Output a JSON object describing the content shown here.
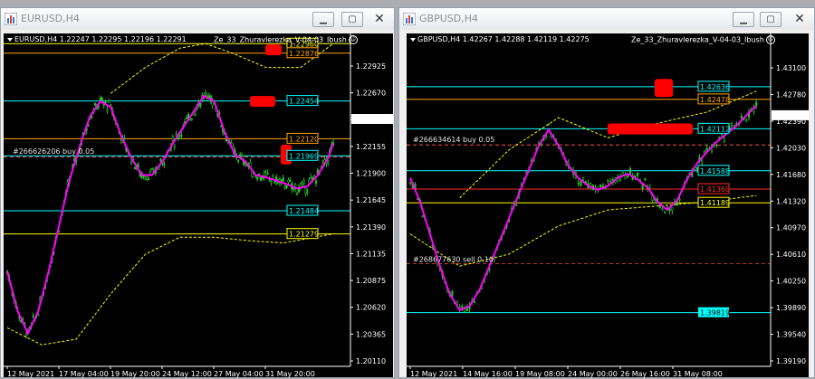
{
  "colors": {
    "background": "#000000",
    "bull_candle": "#22c322",
    "bear_candle": "#22c322",
    "ma_line": "#ff00ff",
    "envelope_line": "#ffff00",
    "cyan_line": "#00ffff",
    "orange_line": "#ffa500",
    "red_line": "#ff2a2a",
    "marker": "#ff0000"
  },
  "windows": [
    {
      "title": "EURUSD,H4",
      "header": "EURUSD,H4  1.22247 1.22295 1.22196 1.22291",
      "indicator": "Ze_33_Zhuravlerezka_V-04-03_Ibush",
      "current_price": "1.22291",
      "price_axis": [
        "1.22925",
        "1.22670",
        "1.22415",
        "1.22155",
        "1.21900",
        "1.21645",
        "1.21390",
        "1.21135",
        "1.20875",
        "1.20620",
        "1.20365",
        "1.20110"
      ],
      "time_axis": [
        "12 May 2021",
        "17 May 04:00",
        "19 May 20:00",
        "24 May 12:00",
        "27 May 04:00",
        "31 May 20:00"
      ],
      "level_labels": [
        {
          "text": "1.22960",
          "color": "yellow"
        },
        {
          "text": "1.22876",
          "color": "orange"
        },
        {
          "text": "1.22454",
          "color": "cyan"
        },
        {
          "text": "1.22120",
          "color": "orange"
        },
        {
          "text": "1.21969",
          "color": "cyan"
        },
        {
          "text": "1.21484",
          "color": "cyan"
        },
        {
          "text": "1.21279",
          "color": "yellow"
        }
      ],
      "order_label": "#266626206 buy 0.05",
      "chart_data": {
        "type": "candlestick",
        "x_range": [
          "12 May 2021",
          "31 May 20:00"
        ],
        "ylim": [
          1.2011,
          1.2305
        ],
        "levels": [
          1.2296,
          1.22876,
          1.22454,
          1.2212,
          1.21969,
          1.21484,
          1.21279
        ],
        "moving_average": [
          [
            0,
            1.2095
          ],
          [
            6,
            1.206
          ],
          [
            12,
            1.204
          ],
          [
            18,
            1.206
          ],
          [
            24,
            1.2095
          ],
          [
            30,
            1.2135
          ],
          [
            36,
            1.2175
          ],
          [
            42,
            1.2205
          ],
          [
            48,
            1.2232
          ],
          [
            54,
            1.2245
          ],
          [
            60,
            1.224
          ],
          [
            66,
            1.2215
          ],
          [
            72,
            1.2195
          ],
          [
            78,
            1.218
          ],
          [
            84,
            1.218
          ],
          [
            90,
            1.2192
          ],
          [
            96,
            1.2208
          ],
          [
            102,
            1.2222
          ],
          [
            108,
            1.2236
          ],
          [
            114,
            1.225
          ],
          [
            120,
            1.2245
          ],
          [
            126,
            1.2218
          ],
          [
            132,
            1.2198
          ],
          [
            138,
            1.2192
          ],
          [
            144,
            1.218
          ],
          [
            150,
            1.2178
          ],
          [
            156,
            1.2175
          ],
          [
            162,
            1.2172
          ],
          [
            168,
            1.2168
          ],
          [
            174,
            1.217
          ],
          [
            180,
            1.218
          ],
          [
            186,
            1.2195
          ],
          [
            189,
            1.2208
          ]
        ],
        "envelope_upper": [
          [
            60,
            1.2252
          ],
          [
            80,
            1.2275
          ],
          [
            100,
            1.2292
          ],
          [
            115,
            1.2296
          ],
          [
            130,
            1.2288
          ],
          [
            150,
            1.2275
          ],
          [
            170,
            1.2275
          ],
          [
            189,
            1.2296
          ]
        ],
        "envelope_lower": [
          [
            0,
            1.2045
          ],
          [
            20,
            1.203
          ],
          [
            40,
            1.2035
          ],
          [
            60,
            1.2075
          ],
          [
            80,
            1.211
          ],
          [
            100,
            1.2125
          ],
          [
            120,
            1.2125
          ],
          [
            140,
            1.2122
          ],
          [
            160,
            1.212
          ],
          [
            189,
            1.2128
          ]
        ]
      }
    },
    {
      "title": "GBPUSD,H4",
      "header": "GBPUSD,H4  1.42267 1.42288 1.42119 1.42275",
      "indicator": "Ze_33_Zhuravlerezka_V-04-03_Ibush",
      "current_price": "1.42275",
      "price_axis": [
        "1.43100",
        "1.42780",
        "1.42390",
        "1.42030",
        "1.41680",
        "1.41320",
        "1.40970",
        "1.40610",
        "1.40250",
        "1.39890",
        "1.39540",
        "1.39190"
      ],
      "time_axis": [
        "12 May 2021",
        "14 May 16:00",
        "19 May 08:00",
        "24 May 00:00",
        "26 May 16:00",
        "31 May 08:00"
      ],
      "level_labels": [
        {
          "text": "1.42636",
          "color": "cyan"
        },
        {
          "text": "1.42478",
          "color": "orange"
        },
        {
          "text": "1.42112",
          "color": "cyan"
        },
        {
          "text": "1.41588",
          "color": "cyan"
        },
        {
          "text": "1.41360",
          "color": "red"
        },
        {
          "text": "1.41189",
          "color": "yellow"
        },
        {
          "text": "1.39819",
          "color": "cyan-filled"
        }
      ],
      "order_labels": [
        "#266634614 buy 0.05",
        "#268677630 sell 0.10"
      ],
      "chart_data": {
        "type": "candlestick",
        "x_range": [
          "12 May 2021",
          "31 May 08:00"
        ],
        "ylim": [
          1.3915,
          1.433
        ],
        "levels": [
          1.42636,
          1.42478,
          1.42112,
          1.41588,
          1.4136,
          1.41189,
          1.39819
        ],
        "moving_average": [
          [
            0,
            1.415
          ],
          [
            4,
            1.412
          ],
          [
            8,
            1.408
          ],
          [
            12,
            1.404
          ],
          [
            16,
            1.4005
          ],
          [
            20,
            1.3985
          ],
          [
            24,
            1.399
          ],
          [
            28,
            1.401
          ],
          [
            32,
            1.404
          ],
          [
            36,
            1.407
          ],
          [
            40,
            1.41
          ],
          [
            44,
            1.413
          ],
          [
            48,
            1.416
          ],
          [
            52,
            1.419
          ],
          [
            56,
            1.421
          ],
          [
            60,
            1.419
          ],
          [
            64,
            1.4165
          ],
          [
            68,
            1.415
          ],
          [
            72,
            1.414
          ],
          [
            76,
            1.4135
          ],
          [
            80,
            1.414
          ],
          [
            84,
            1.415
          ],
          [
            88,
            1.4155
          ],
          [
            92,
            1.4148
          ],
          [
            96,
            1.4138
          ],
          [
            100,
            1.412
          ],
          [
            104,
            1.411
          ],
          [
            108,
            1.4122
          ],
          [
            112,
            1.4148
          ],
          [
            116,
            1.4168
          ],
          [
            120,
            1.4182
          ],
          [
            124,
            1.4195
          ],
          [
            128,
            1.4205
          ],
          [
            132,
            1.4215
          ],
          [
            136,
            1.4228
          ],
          [
            140,
            1.424
          ]
        ],
        "envelope_upper": [
          [
            20,
            1.4125
          ],
          [
            40,
            1.4185
          ],
          [
            60,
            1.4225
          ],
          [
            80,
            1.42
          ],
          [
            100,
            1.4218
          ],
          [
            120,
            1.4232
          ],
          [
            140,
            1.4258
          ]
        ],
        "envelope_lower": [
          [
            0,
            1.408
          ],
          [
            20,
            1.404
          ],
          [
            40,
            1.4055
          ],
          [
            60,
            1.409
          ],
          [
            80,
            1.411
          ],
          [
            100,
            1.4115
          ],
          [
            120,
            1.412
          ],
          [
            140,
            1.4128
          ]
        ]
      }
    }
  ]
}
